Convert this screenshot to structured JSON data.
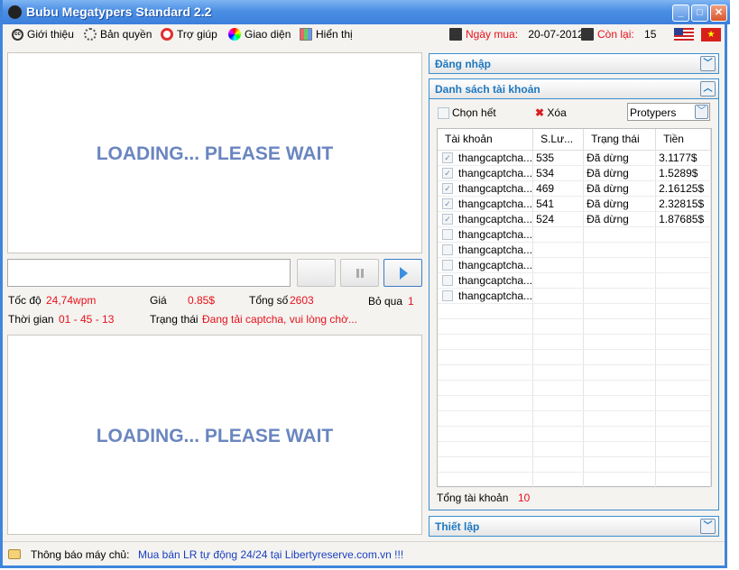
{
  "window": {
    "title": "Bubu Megatypers Standard 2.2"
  },
  "menu": [
    {
      "label": "Giới thiệu",
      "icon": "cc-icon"
    },
    {
      "label": "Bản quyền",
      "icon": "fingerprint-icon"
    },
    {
      "label": "Trợ giúp",
      "icon": "lifebuoy-icon"
    },
    {
      "label": "Giao diện",
      "icon": "color-wheel-icon"
    },
    {
      "label": "Hiển thị",
      "icon": "display-icon"
    }
  ],
  "license": {
    "purchase_label": "Ngày mua:",
    "purchase_date": "20-07-2012",
    "remaining_label": "Còn lại:",
    "remaining": "15"
  },
  "captcha": {
    "loading_top": "LOADING... PLEASE WAIT",
    "loading_bottom": "LOADING... PLEASE WAIT",
    "input_value": ""
  },
  "stats": {
    "speed_label": "Tốc độ",
    "speed": "24,74wpm",
    "price_label": "Giá",
    "price": "0.85$",
    "total_label": "Tổng số",
    "total": "2603",
    "skip_label": "Bỏ qua",
    "skip": "1",
    "time_label": "Thời gian",
    "time": "01 - 45 - 13",
    "status_label": "Trạng thái",
    "status": "Đang tải captcha, vui lòng chờ..."
  },
  "right": {
    "login_header": "Đăng nhập",
    "accounts_header": "Danh sách tài khoản",
    "select_all": "Chọn hết",
    "delete": "Xóa",
    "service": "Protypers",
    "settings_header": "Thiết lập",
    "total_label": "Tổng tài khoản",
    "total": "10"
  },
  "table": {
    "columns": [
      "Tài khoản",
      "S.Lư...",
      "Trạng thái",
      "Tiền"
    ],
    "rows": [
      {
        "checked": true,
        "account": "thangcaptcha...",
        "count": "535",
        "status": "Đã dừng",
        "money": "3.1177$"
      },
      {
        "checked": true,
        "account": "thangcaptcha...",
        "count": "534",
        "status": "Đã dừng",
        "money": "1.5289$"
      },
      {
        "checked": true,
        "account": "thangcaptcha...",
        "count": "469",
        "status": "Đã dừng",
        "money": "2.16125$"
      },
      {
        "checked": true,
        "account": "thangcaptcha...",
        "count": "541",
        "status": "Đã dừng",
        "money": "2.32815$"
      },
      {
        "checked": true,
        "account": "thangcaptcha...",
        "count": "524",
        "status": "Đã dừng",
        "money": "1.87685$"
      },
      {
        "checked": false,
        "account": "thangcaptcha...",
        "count": "",
        "status": "",
        "money": ""
      },
      {
        "checked": false,
        "account": "thangcaptcha...",
        "count": "",
        "status": "",
        "money": ""
      },
      {
        "checked": false,
        "account": "thangcaptcha...",
        "count": "",
        "status": "",
        "money": ""
      },
      {
        "checked": false,
        "account": "thangcaptcha...",
        "count": "",
        "status": "",
        "money": ""
      },
      {
        "checked": false,
        "account": "thangcaptcha...",
        "count": "",
        "status": "",
        "money": ""
      }
    ]
  },
  "footer": {
    "label": "Thông báo máy chủ:",
    "message": "Mua bán LR tự động 24/24 tại Libertyreserve.com.vn !!!"
  },
  "colors": {
    "accent": "#3a8fd0",
    "value": "#e8101a",
    "link": "#1a3fc0"
  }
}
